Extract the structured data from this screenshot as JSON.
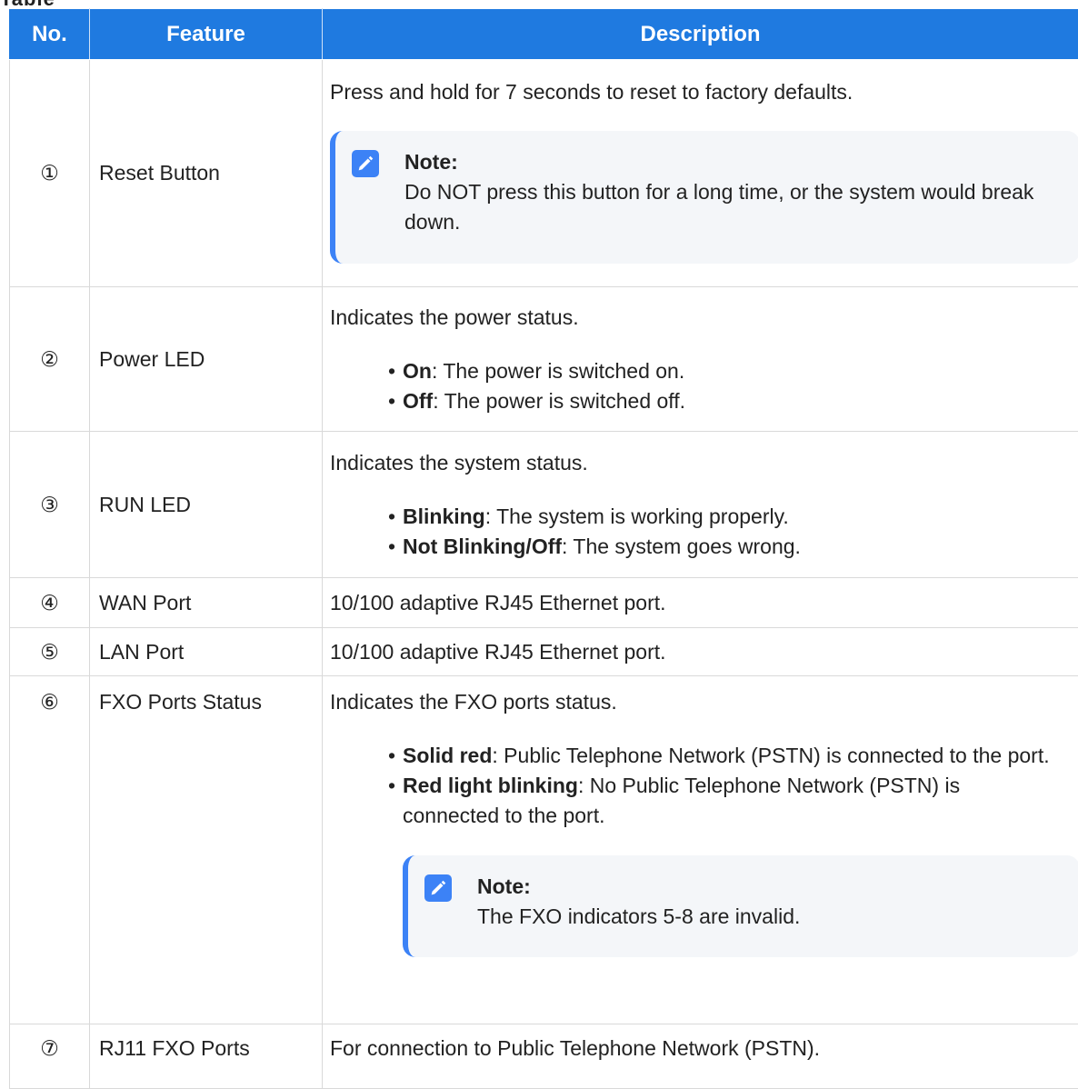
{
  "header": {
    "no": "No.",
    "feature": "Feature",
    "description": "Description"
  },
  "top_strip_text": "Table",
  "rows": [
    {
      "no": "①",
      "feature": "Reset Button",
      "text": "Press and hold for 7 seconds to reset to factory defaults.",
      "note_label": "Note:",
      "note_text": "Do NOT press this button for a long time, or the system would break down."
    },
    {
      "no": "②",
      "feature": "Power LED",
      "text": "Indicates the power status.",
      "bullets": [
        {
          "term": "On",
          "desc": ": The power is switched on."
        },
        {
          "term": "Off",
          "desc": ": The power is switched off."
        }
      ]
    },
    {
      "no": "③",
      "feature": "RUN LED",
      "text": "Indicates the system status.",
      "bullets": [
        {
          "term": "Blinking",
          "desc": ": The system is working properly."
        },
        {
          "term": "Not Blinking/Off",
          "desc": ": The system goes wrong."
        }
      ]
    },
    {
      "no": "④",
      "feature": "WAN Port",
      "text": "10/100 adaptive RJ45 Ethernet port."
    },
    {
      "no": "⑤",
      "feature": "LAN Port",
      "text": "10/100 adaptive RJ45 Ethernet port."
    },
    {
      "no": "⑥",
      "feature": "FXO Ports Status",
      "text": "Indicates the FXO ports status.",
      "bullets": [
        {
          "term": "Solid red",
          "desc": ": Public Telephone Network (PSTN) is connected to the port."
        },
        {
          "term": "Red light blinking",
          "desc": ": No Public Telephone Network (PSTN) is connected to the port."
        }
      ],
      "note_label": "Note:",
      "note_text": "The FXO indicators 5-8 are invalid."
    },
    {
      "no": "⑦",
      "feature": "RJ11 FXO Ports",
      "text": "For connection to Public Telephone Network (PSTN)."
    }
  ],
  "colors": {
    "header_bg": "#1f7ae0",
    "note_accent": "#3c82f6",
    "note_bg": "#f4f6f9",
    "border": "#d9d9d9"
  },
  "icons": {
    "note": "pencil-icon"
  }
}
